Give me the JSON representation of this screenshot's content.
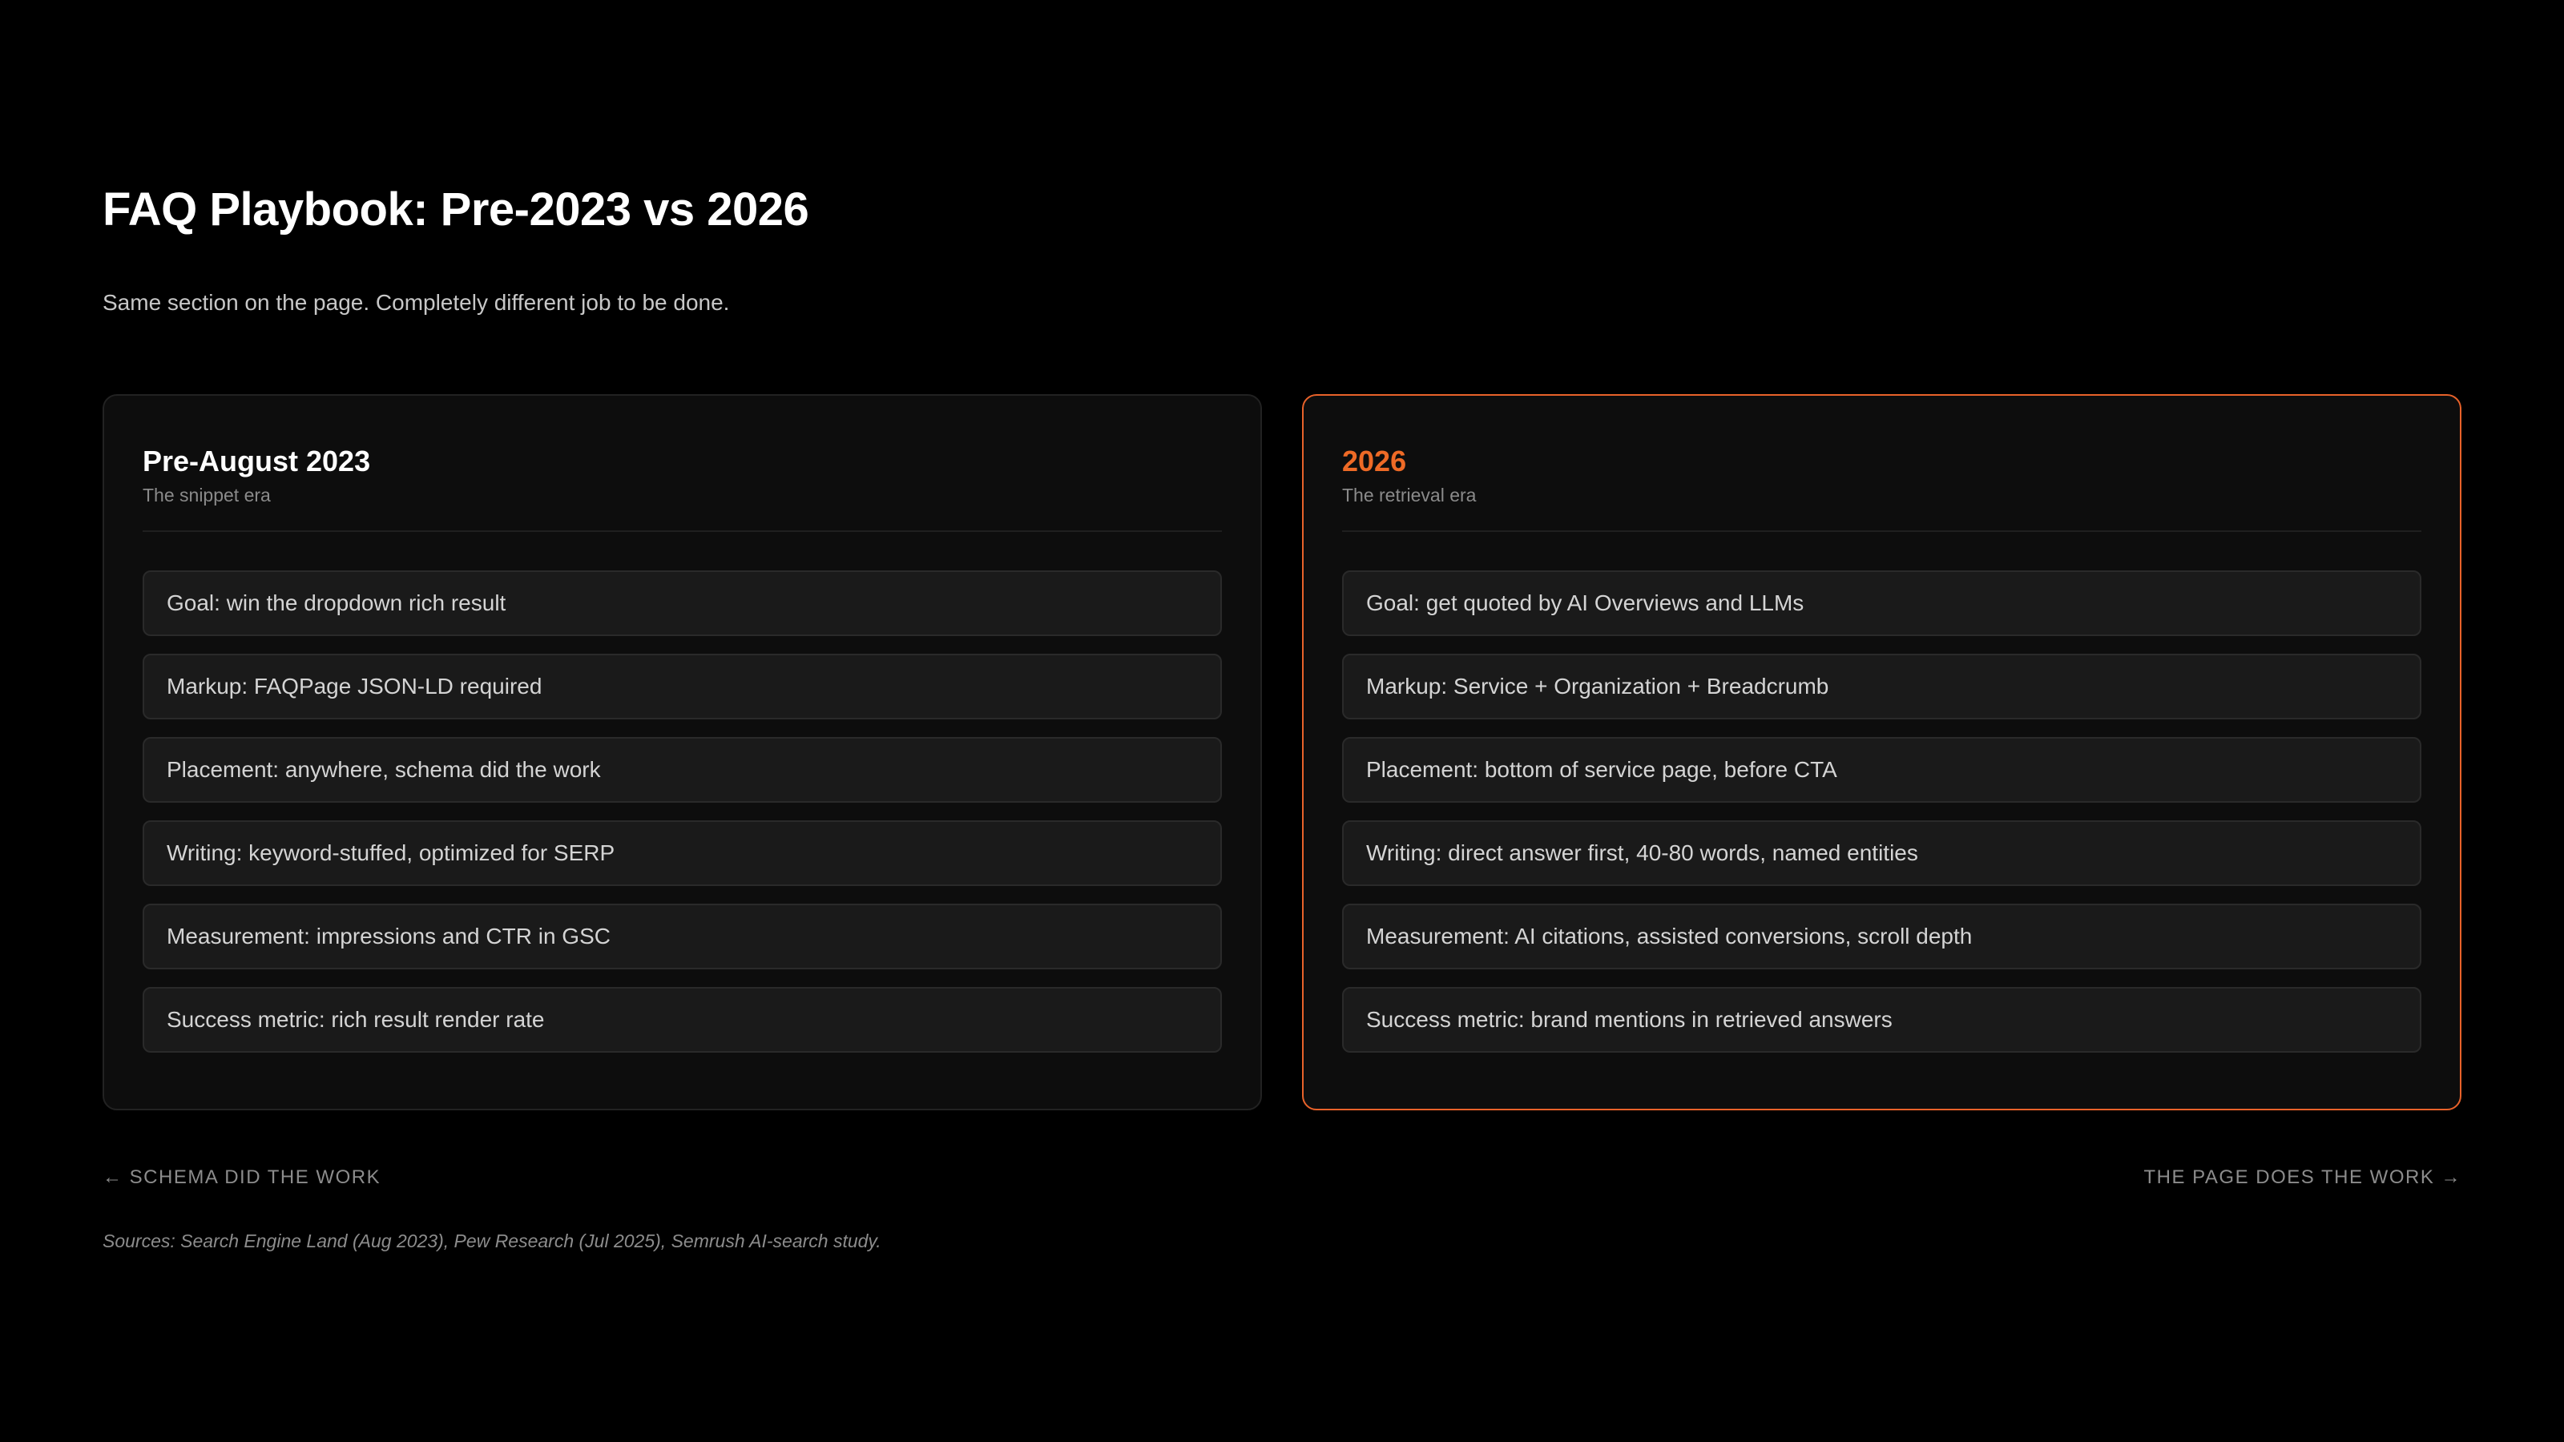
{
  "header": {
    "title": "FAQ Playbook: Pre-2023 vs 2026",
    "subtitle": "Same section on the page. Completely different job to be done."
  },
  "columns": [
    {
      "title": "Pre-August 2023",
      "subtitle": "The snippet era",
      "items": [
        "Goal: win the dropdown rich result",
        "Markup: FAQPage JSON-LD required",
        "Placement: anywhere, schema did the work",
        "Writing: keyword-stuffed, optimized for SERP",
        "Measurement: impressions and CTR in GSC",
        "Success metric: rich result render rate"
      ]
    },
    {
      "title": "2026",
      "subtitle": "The retrieval era",
      "items": [
        "Goal: get quoted by AI Overviews and LLMs",
        "Markup: Service + Organization + Breadcrumb",
        "Placement: bottom of service page, before CTA",
        "Writing: direct answer first, 40-80 words, named entities",
        "Measurement: AI citations, assisted conversions, scroll depth",
        "Success metric: brand mentions in retrieved answers"
      ]
    }
  ],
  "footer": {
    "left_label": "← SCHEMA DID THE WORK",
    "right_label": "THE PAGE DOES THE WORK →",
    "sources": "Sources: Search Engine Land (Aug 2023), Pew Research (Jul 2025), Semrush AI-search study."
  },
  "colors": {
    "background": "#000000",
    "card_background": "#0d0d0d",
    "item_background": "#1a1a1a",
    "accent": "#ee6a26"
  }
}
